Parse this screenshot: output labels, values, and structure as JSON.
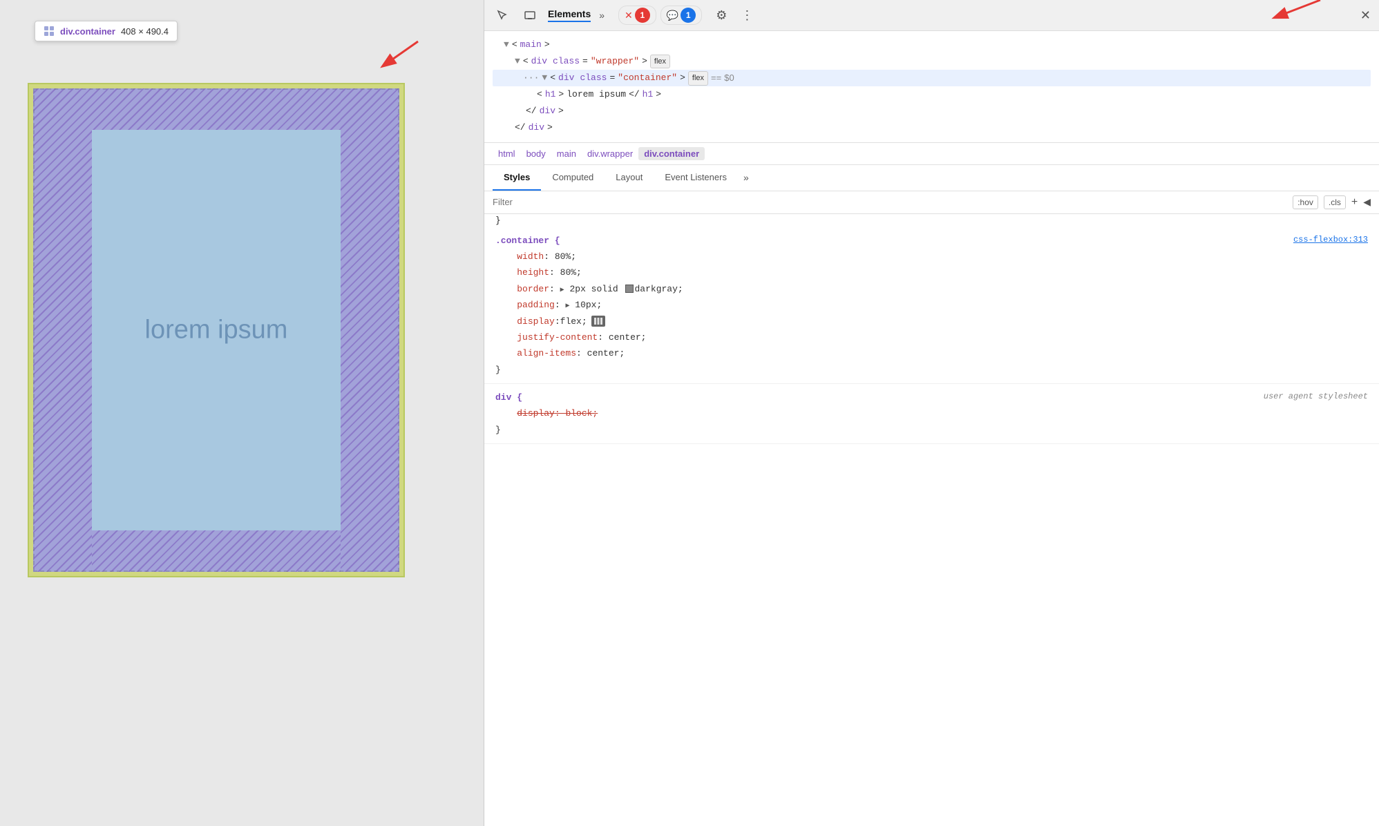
{
  "viewport": {
    "tooltip": {
      "element": "div.container",
      "dimensions": "408 × 490.4"
    },
    "content": "lorem ipsum"
  },
  "devtools": {
    "header": {
      "elements_tab": "Elements",
      "badge_red": "1",
      "badge_blue": "1"
    },
    "dom": {
      "main_open": "<main>",
      "wrapper_open": "<div class=\"wrapper\">",
      "container_open": "<div class=\"container\">",
      "flex_badge": "flex",
      "flex_badge2": "flex",
      "equals": "==",
      "dollar_zero": "$0",
      "h1": "<h1>lorem ipsum</h1>",
      "div_close": "</div>",
      "div_close2": "</div>",
      "three_dots": "..."
    },
    "breadcrumbs": [
      "html",
      "body",
      "main",
      "div.wrapper",
      "div.container"
    ],
    "tabs": [
      "Styles",
      "Computed",
      "Layout",
      "Event Listeners",
      ">>"
    ],
    "filter": {
      "placeholder": "Filter",
      "hov": ":hov",
      "cls": ".cls"
    },
    "rules": [
      {
        "selector": ".container {",
        "source": "css-flexbox:313",
        "properties": [
          {
            "prop": "width",
            "value": "80%",
            "strikethrough": false
          },
          {
            "prop": "height",
            "value": "80%",
            "strikethrough": false
          },
          {
            "prop": "border",
            "value": "▶ 2px solid  darkgray;",
            "strikethrough": false,
            "has_swatch": true
          },
          {
            "prop": "padding",
            "value": "▶ 10px;",
            "strikethrough": false
          },
          {
            "prop": "display",
            "value": "flex;",
            "strikethrough": false,
            "has_flex_icon": true
          },
          {
            "prop": "justify-content",
            "value": "center;",
            "strikethrough": false
          },
          {
            "prop": "align-items",
            "value": "center;",
            "strikethrough": false
          }
        ]
      },
      {
        "selector": "div {",
        "source": "user agent stylesheet",
        "source_italic": true,
        "properties": [
          {
            "prop": "display",
            "value": "block;",
            "strikethrough": true
          }
        ]
      }
    ]
  }
}
